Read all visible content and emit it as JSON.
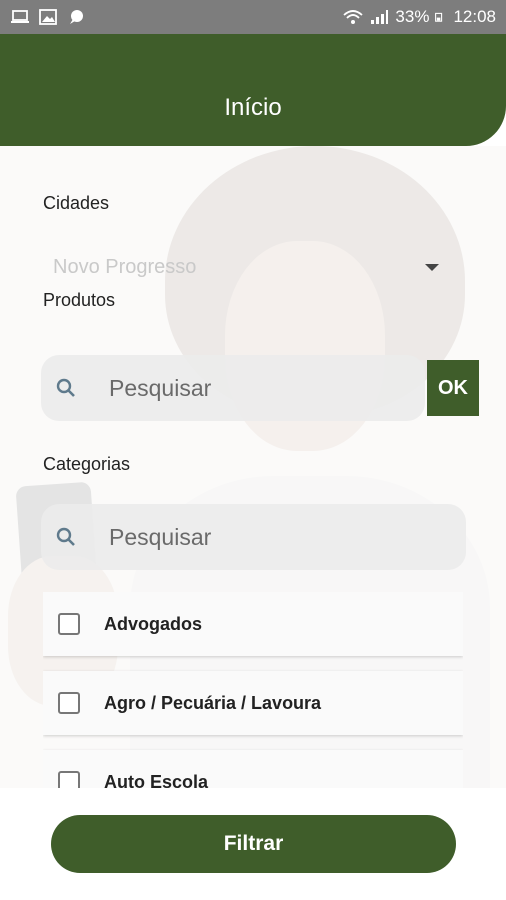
{
  "status_bar": {
    "battery": "33%",
    "time": "12:08",
    "left_icons": [
      "laptop-icon",
      "image-icon",
      "chat-icon"
    ],
    "right_icons": [
      "wifi-icon",
      "signal-icon",
      "battery-icon"
    ]
  },
  "header": {
    "title": "Início"
  },
  "cidades": {
    "label": "Cidades",
    "selected": "Novo Progresso"
  },
  "produtos": {
    "label": "Produtos",
    "search_placeholder": "Pesquisar",
    "ok_label": "OK"
  },
  "categorias": {
    "label": "Categorias",
    "search_placeholder": "Pesquisar",
    "items": [
      {
        "label": "Advogados",
        "checked": false
      },
      {
        "label": "Agro / Pecuária / Lavoura",
        "checked": false
      },
      {
        "label": "Auto Escola",
        "checked": false
      }
    ]
  },
  "footer": {
    "filter_label": "Filtrar"
  },
  "colors": {
    "primary": "#3f5d2a",
    "status_bar": "#7d7d7d"
  }
}
